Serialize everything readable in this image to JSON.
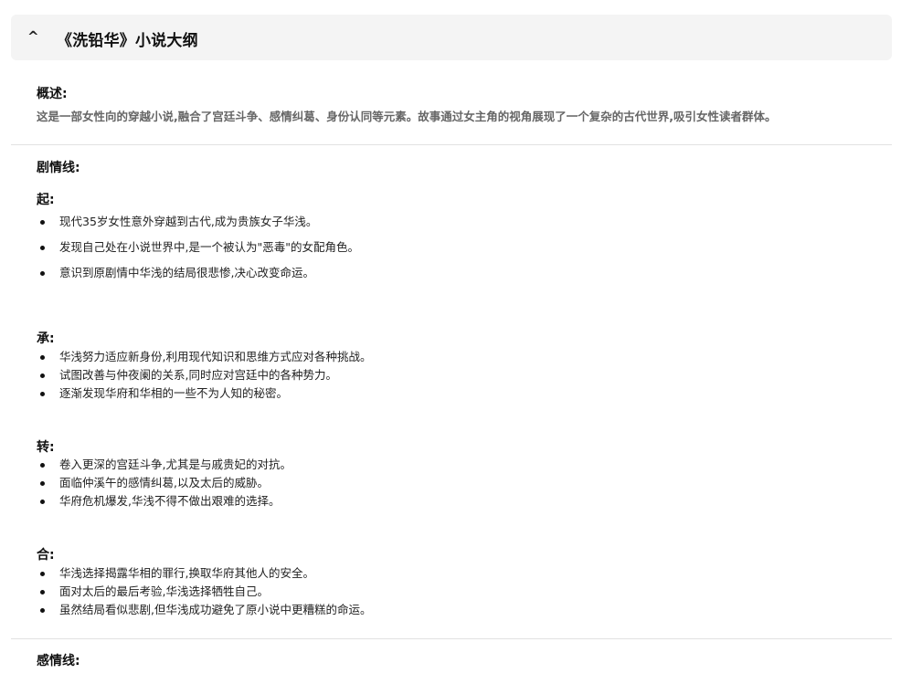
{
  "header": {
    "toggle_icon": "^",
    "title": "《洗铅华》小说大纲"
  },
  "overview": {
    "label": "概述:",
    "text": "这是一部女性向的穿越小说,融合了宫廷斗争、感情纠葛、身份认同等元素。故事通过女主角的视角展现了一个复杂的古代世界,吸引女性读者群体。"
  },
  "plot": {
    "label": "剧情线:",
    "sections": [
      {
        "label": "起:",
        "items": [
          "现代35岁女性意外穿越到古代,成为贵族女子华浅。",
          "发现自己处在小说世界中,是一个被认为\"恶毒\"的女配角色。",
          "意识到原剧情中华浅的结局很悲惨,决心改变命运。"
        ]
      },
      {
        "label": "承:",
        "items": [
          "华浅努力适应新身份,利用现代知识和思维方式应对各种挑战。",
          "试图改善与仲夜阑的关系,同时应对宫廷中的各种势力。",
          "逐渐发现华府和华相的一些不为人知的秘密。"
        ]
      },
      {
        "label": "转:",
        "items": [
          "卷入更深的宫廷斗争,尤其是与戚贵妃的对抗。",
          "面临仲溪午的感情纠葛,以及太后的威胁。",
          "华府危机爆发,华浅不得不做出艰难的选择。"
        ]
      },
      {
        "label": "合:",
        "items": [
          "华浅选择揭露华相的罪行,换取华府其他人的安全。",
          "面对太后的最后考验,华浅选择牺牲自己。",
          "虽然结局看似悲剧,但华浅成功避免了原小说中更糟糕的命运。"
        ]
      }
    ]
  },
  "romance": {
    "label": "感情线:"
  }
}
